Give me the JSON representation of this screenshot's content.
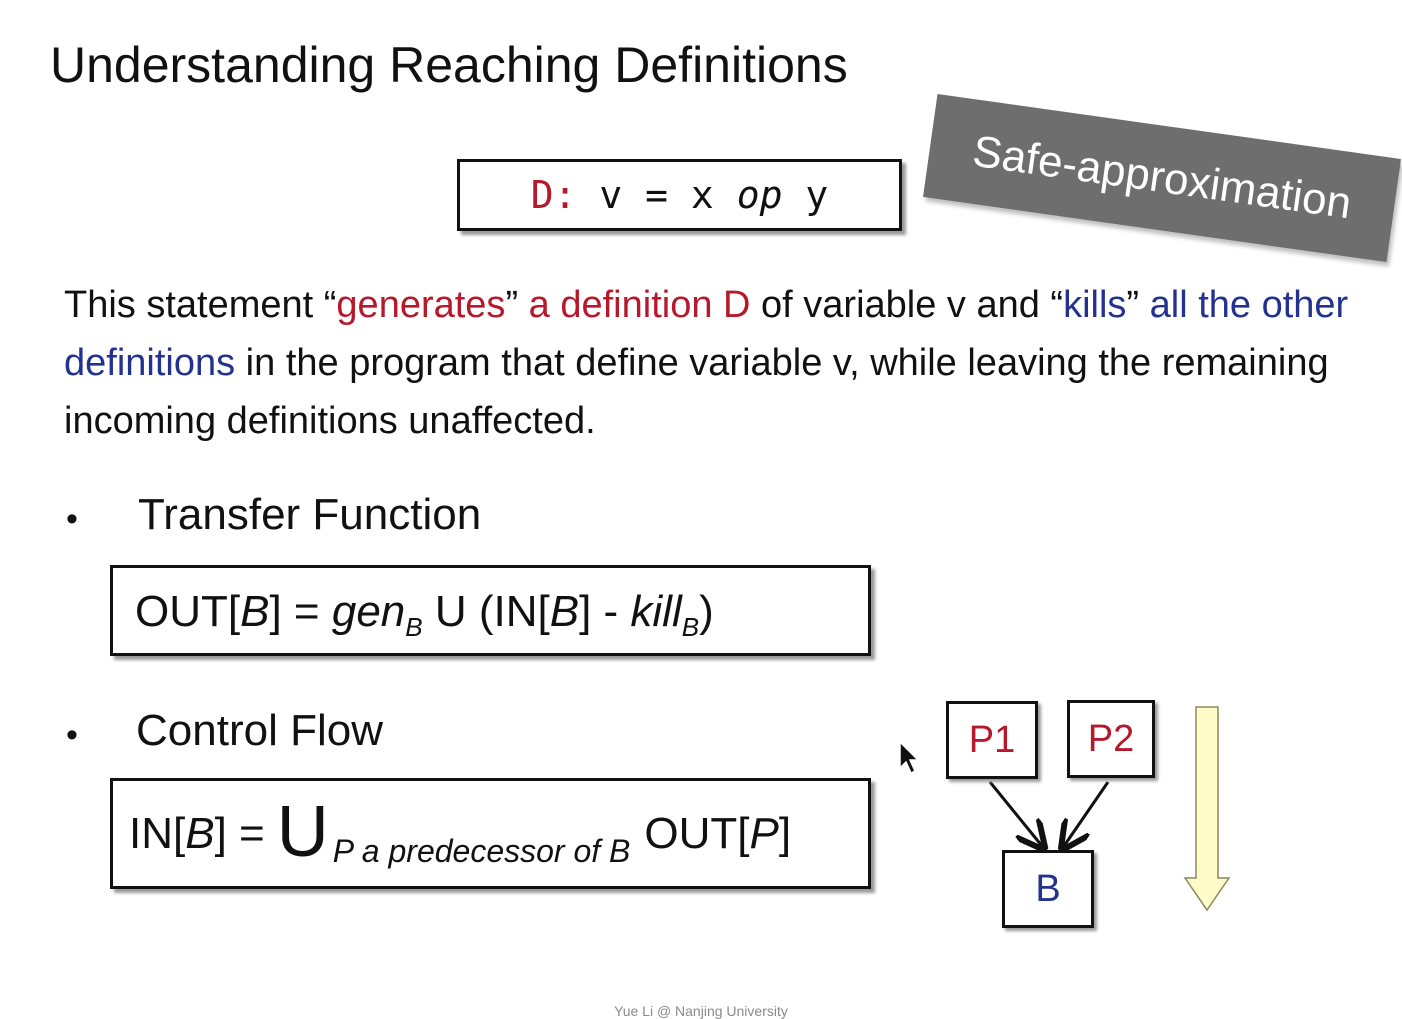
{
  "slide": {
    "title": "Understanding Reaching Definitions",
    "code": {
      "label": "D:",
      "before_op": " v = x ",
      "op": "op",
      "after_op": " y"
    },
    "banner": "Safe-approximation",
    "paragraph": {
      "t1": "This statement “",
      "t2": "generates",
      "t3": "” ",
      "t4": "a definition D",
      "t5": " of variable v and “",
      "t6": "kills",
      "t7": "” ",
      "t8": "all the other definitions",
      "t9": " in the program that define variable v, while leaving the remaining incoming definitions unaffected."
    },
    "bullets": [
      {
        "symbol": "•",
        "label": "Transfer Function"
      },
      {
        "symbol": "•",
        "label": "Control Flow"
      }
    ],
    "transfer_formula": {
      "a": "OUT[",
      "b": "B",
      "c": "] = ",
      "gen": "gen",
      "gen_sub": "B",
      "union": " U (IN[",
      "b2": "B",
      "minus": "] - ",
      "kill": "kill",
      "kill_sub": "B",
      "end": ")"
    },
    "control_formula": {
      "a": "IN[",
      "b": "B",
      "c": "] =",
      "big_union": "U",
      "sub": "P a predecessor of B",
      "d": "OUT[",
      "p": "P",
      "e": "]"
    },
    "diagram": {
      "nodes": {
        "p1": "P1",
        "p2": "P2",
        "b": "B"
      },
      "colors": {
        "pred": "#b5192b",
        "target": "#23328e",
        "flow_arrow_fill": "#fdfbc8"
      }
    },
    "footer": "Yue Li @ Nanjing University"
  }
}
